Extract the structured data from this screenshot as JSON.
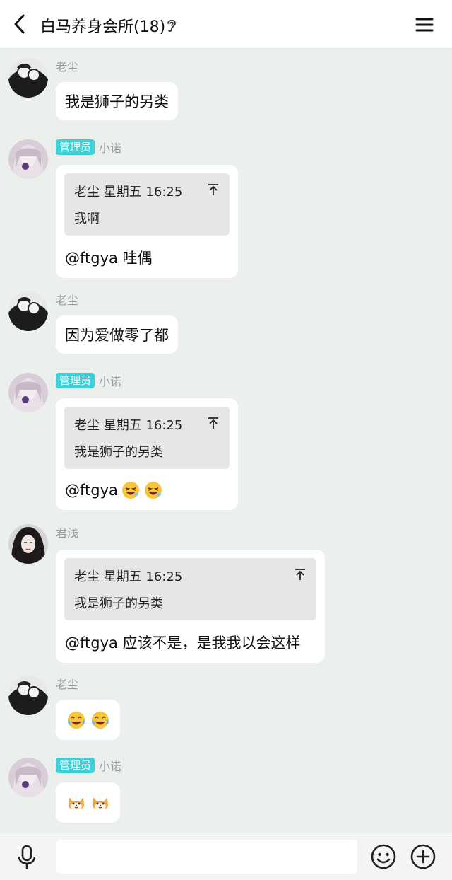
{
  "header": {
    "title": "白马养身会所(18)",
    "icons": {
      "back": "chevron-left-icon",
      "ear": "ear-icon",
      "menu": "menu-icon"
    }
  },
  "messages": [
    {
      "sender": "老尘",
      "text": "我是狮子的另类"
    },
    {
      "badge": "管理员",
      "sender": "小诺",
      "quote": {
        "header": "老尘 星期五 16:25",
        "text": "我啊"
      },
      "reply": "@ftgya 哇偶"
    },
    {
      "sender": "老尘",
      "text": "因为爱做零了都"
    },
    {
      "badge": "管理员",
      "sender": "小诺",
      "quote": {
        "header": "老尘 星期五 16:25",
        "text": "我是狮子的另类"
      },
      "reply": "@ftgya",
      "emojis": [
        "laughing-wink-emoji",
        "laughing-wink-emoji"
      ]
    },
    {
      "sender": "君浅",
      "quote": {
        "header": "老尘 星期五 16:25",
        "text": "我是狮子的另类"
      },
      "reply": "@ftgya 应该不是，是我我以会这样"
    },
    {
      "sender": "老尘",
      "emojis": [
        "tears-of-joy-emoji",
        "tears-of-joy-emoji"
      ]
    },
    {
      "badge": "管理员",
      "sender": "小诺",
      "emojis": [
        "shiba-dog-emoji",
        "shiba-dog-emoji"
      ]
    }
  ],
  "footer": {
    "input_value": "",
    "icons": {
      "mic": "microphone-icon",
      "emoji": "smiley-icon",
      "plus": "plus-icon"
    }
  },
  "colors": {
    "background": "#ecf0ed",
    "badge": "#3fcfd6",
    "bubble": "#ffffff",
    "quote": "#e6e6e6"
  }
}
